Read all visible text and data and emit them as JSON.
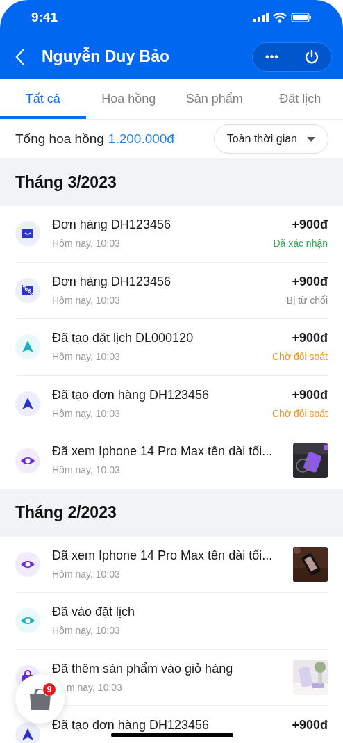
{
  "status_bar": {
    "time": "9:41"
  },
  "header": {
    "title": "Nguyễn Duy Bảo",
    "more_label": "•••"
  },
  "tabs": [
    {
      "label": "Tất cả",
      "selected": true
    },
    {
      "label": "Hoa hồng",
      "selected": false
    },
    {
      "label": "Sản phẩm",
      "selected": false
    },
    {
      "label": "Đặt lịch",
      "selected": false
    }
  ],
  "summary": {
    "label": "Tổng hoa hồng",
    "amount": "1.200.000đ",
    "filter": "Toàn thời gian"
  },
  "sections": [
    {
      "title": "Tháng 3/2023",
      "items": [
        {
          "kind": "bag",
          "color": "#2d35c9",
          "title": "Đơn hàng DH123456",
          "time": "Hôm nay, 10:03",
          "amount": "+900đ",
          "status": {
            "text": "Đã xác nhận",
            "color": "#34a853"
          }
        },
        {
          "kind": "bag-off",
          "color": "#2d35c9",
          "title": "Đơn hàng DH123456",
          "time": "Hôm nay, 10:03",
          "amount": "+900đ",
          "status": {
            "text": "Bị từ chối",
            "color": "#8a8a8a"
          }
        },
        {
          "kind": "send",
          "color": "#19b3c4",
          "title": "Đã tạo đặt lịch DL000120",
          "time": "Hôm nay, 10:03",
          "amount": "+900đ",
          "status": {
            "text": "Chờ đối soát",
            "color": "#f7931e"
          }
        },
        {
          "kind": "send",
          "color": "#2d35c9",
          "title": "Đã tạo đơn hàng DH123456",
          "time": "Hôm nay, 10:03",
          "amount": "+900đ",
          "status": {
            "text": "Chờ đối soát",
            "color": "#f7931e"
          }
        },
        {
          "kind": "eye",
          "color": "#6c2bd9",
          "title": "Đã xem Iphone 14 Pro Max tên dài tối...",
          "time": "Hôm nay, 10:03"
        }
      ]
    },
    {
      "title": "Tháng 2/2023",
      "items": [
        {
          "kind": "eye",
          "color": "#6c2bd9",
          "title": "Đã xem Iphone 14 Pro Max tên dài tối...",
          "time": "Hôm nay, 10:03"
        },
        {
          "kind": "eye",
          "color": "#19b3c4",
          "title": "Đã vào đặt lịch",
          "time": "Hôm nay, 10:03"
        },
        {
          "kind": "cart",
          "color": "#6c2bd9",
          "title": "Đã thêm sản phẩm vào giỏ hàng",
          "time": "m nay, 10:03"
        },
        {
          "kind": "send",
          "color": "#2d35c9",
          "title": "Đã tạo đơn hàng DH123456",
          "amount": "+900đ"
        }
      ]
    }
  ],
  "cart": {
    "count": "9"
  }
}
